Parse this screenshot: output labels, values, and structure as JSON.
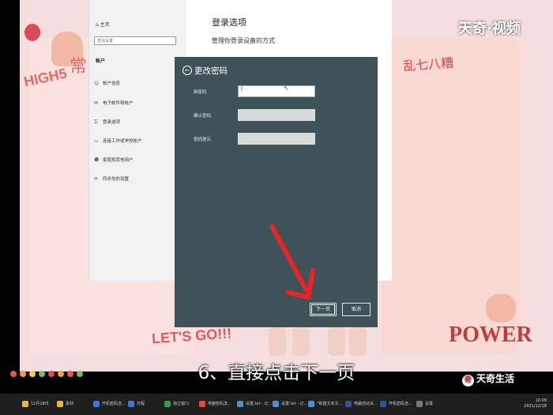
{
  "desktop": {
    "sticker_high5": "HIGH5",
    "sticker_changm": "常",
    "sticker_luan": "乱七八糟",
    "sticker_letsgo": "LET'S GO!!!",
    "sticker_power": "POWER",
    "dot_colors": [
      "#e8564f",
      "#f0a13c",
      "#f2d04a",
      "#6cbf6a",
      "#d94b5c",
      "#f0a13c",
      "#e8564f",
      "#6cbf6a"
    ]
  },
  "settings": {
    "home": "主页",
    "search_placeholder": "查找设置",
    "section": "帐户",
    "nav": [
      {
        "icon": "☺",
        "label": "帐户信息"
      },
      {
        "icon": "✉",
        "label": "电子邮件和帐户"
      },
      {
        "icon": "⚿",
        "label": "登录选项"
      },
      {
        "icon": "▭",
        "label": "连接工作或学校帐户"
      },
      {
        "icon": "☻",
        "label": "家庭和其他用户"
      },
      {
        "icon": "⟳",
        "label": "同步你的设置"
      }
    ],
    "main_title": "登录选项",
    "main_subtitle": "管理你登录设备的方式"
  },
  "dialog": {
    "title": "更改密码",
    "fields": [
      {
        "label": "新密码",
        "value": "|",
        "active": true
      },
      {
        "label": "确认密码",
        "value": "",
        "active": false
      },
      {
        "label": "密码提示",
        "value": "",
        "active": false
      }
    ],
    "next_label": "下一页",
    "cancel_label": "取消"
  },
  "overlay": {
    "brand_top": "天奇·视频",
    "brand_bottom": "天奇生活",
    "brand_logo": "奇",
    "subtitle": "6、直接点击下一页",
    "arrow_color": "#e8232a"
  },
  "taskbar": {
    "items": [
      {
        "label": "12月18日",
        "color": "#e7b63a"
      },
      {
        "label": "素材",
        "color": "#e7b63a"
      },
      {
        "label": "开机密码怎...",
        "color": "#3a78d9"
      },
      {
        "label": "日程",
        "color": "#3a78d9"
      },
      {
        "label": "独立窗口",
        "color": "#2aa04a"
      },
      {
        "label": "电脑密码怎...",
        "color": "#e04a3a"
      },
      {
        "label": "设置.txt - 记...",
        "color": "#4a90d9"
      },
      {
        "label": "设置.txt - 记...",
        "color": "#4a90d9"
      },
      {
        "label": "*新建文本文...",
        "color": "#4a90d9"
      },
      {
        "label": "电脑自动关...",
        "color": "#2b5797"
      },
      {
        "label": "开机密码怎...",
        "color": "#2b5797"
      },
      {
        "label": "设置",
        "color": "#777777"
      }
    ],
    "time": "10:09",
    "date": "2021/12/18"
  }
}
